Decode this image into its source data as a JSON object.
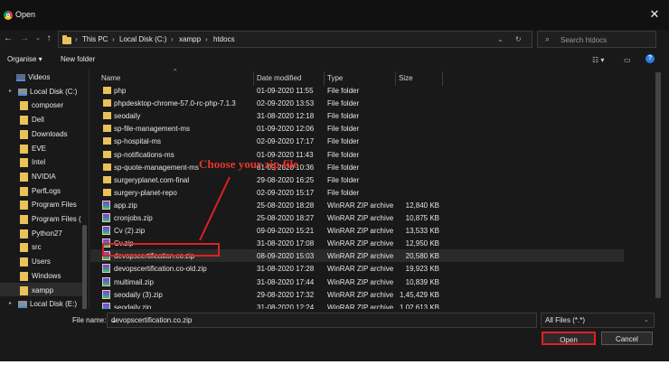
{
  "window": {
    "title": "Open"
  },
  "breadcrumb": [
    "This PC",
    "Local Disk (C:)",
    "xampp",
    "htdocs"
  ],
  "search": {
    "placeholder": "Search htdocs"
  },
  "toolbar": {
    "organise": "Organise ▾",
    "new_folder": "New folder"
  },
  "nav": [
    {
      "label": "Videos",
      "kind": "video",
      "indent": 1
    },
    {
      "label": "Local Disk (C:)",
      "kind": "drive",
      "indent": 0
    },
    {
      "label": "composer",
      "kind": "folder",
      "indent": 2
    },
    {
      "label": "Dell",
      "kind": "folder",
      "indent": 2
    },
    {
      "label": "Downloads",
      "kind": "folder",
      "indent": 2
    },
    {
      "label": "EVE",
      "kind": "folder",
      "indent": 2
    },
    {
      "label": "Intel",
      "kind": "folder",
      "indent": 2
    },
    {
      "label": "NVIDIA",
      "kind": "folder",
      "indent": 2
    },
    {
      "label": "PerfLogs",
      "kind": "folder",
      "indent": 2
    },
    {
      "label": "Program Files",
      "kind": "folder",
      "indent": 2
    },
    {
      "label": "Program Files (",
      "kind": "folder",
      "indent": 2
    },
    {
      "label": "Python27",
      "kind": "folder",
      "indent": 2
    },
    {
      "label": "src",
      "kind": "folder",
      "indent": 2
    },
    {
      "label": "Users",
      "kind": "folder",
      "indent": 2
    },
    {
      "label": "Windows",
      "kind": "folder",
      "indent": 2
    },
    {
      "label": "xampp",
      "kind": "folder",
      "indent": 2,
      "selected": true
    },
    {
      "label": "Local Disk (E:)",
      "kind": "drive",
      "indent": 0
    }
  ],
  "columns": {
    "name": "Name",
    "date": "Date modified",
    "type": "Type",
    "size": "Size"
  },
  "files": [
    {
      "name": "php",
      "date": "01-09-2020 11:55",
      "type": "File folder",
      "size": "",
      "kind": "folder"
    },
    {
      "name": "phpdesktop-chrome-57.0-rc-php-7.1.3",
      "date": "02-09-2020 13:53",
      "type": "File folder",
      "size": "",
      "kind": "folder"
    },
    {
      "name": "seodaily",
      "date": "31-08-2020 12:18",
      "type": "File folder",
      "size": "",
      "kind": "folder"
    },
    {
      "name": "sp-file-management-ms",
      "date": "01-09-2020 12:06",
      "type": "File folder",
      "size": "",
      "kind": "folder"
    },
    {
      "name": "sp-hospital-ms",
      "date": "02-09-2020 17:17",
      "type": "File folder",
      "size": "",
      "kind": "folder"
    },
    {
      "name": "sp-notifications-ms",
      "date": "01-09-2020 11:43",
      "type": "File folder",
      "size": "",
      "kind": "folder"
    },
    {
      "name": "sp-quote-management-ms",
      "date": "01-09-2020 10:36",
      "type": "File folder",
      "size": "",
      "kind": "folder"
    },
    {
      "name": "surgeryplanet.com-final",
      "date": "29-08-2020 16:25",
      "type": "File folder",
      "size": "",
      "kind": "folder"
    },
    {
      "name": "surgery-planet-repo",
      "date": "02-09-2020 15:17",
      "type": "File folder",
      "size": "",
      "kind": "folder"
    },
    {
      "name": "app.zip",
      "date": "25-08-2020 18:28",
      "type": "WinRAR ZIP archive",
      "size": "12,840 KB",
      "kind": "zip"
    },
    {
      "name": "cronjobs.zip",
      "date": "25-08-2020 18:27",
      "type": "WinRAR ZIP archive",
      "size": "10,875 KB",
      "kind": "zip"
    },
    {
      "name": "Cv (2).zip",
      "date": "09-09-2020 15:21",
      "type": "WinRAR ZIP archive",
      "size": "13,533 KB",
      "kind": "zip"
    },
    {
      "name": "Cv.zip",
      "date": "31-08-2020 17:08",
      "type": "WinRAR ZIP archive",
      "size": "12,950 KB",
      "kind": "zip"
    },
    {
      "name": "devopscertification.co.zip",
      "date": "08-09-2020 15:03",
      "type": "WinRAR ZIP archive",
      "size": "20,580 KB",
      "kind": "zip",
      "selected": true
    },
    {
      "name": "devopscertification.co-old.zip",
      "date": "31-08-2020 17:28",
      "type": "WinRAR ZIP archive",
      "size": "19,923 KB",
      "kind": "zip"
    },
    {
      "name": "multimail.zip",
      "date": "31-08-2020 17:44",
      "type": "WinRAR ZIP archive",
      "size": "10,839 KB",
      "kind": "zip"
    },
    {
      "name": "seodaily (3).zip",
      "date": "29-08-2020 17:32",
      "type": "WinRAR ZIP archive",
      "size": "1,45,429 KB",
      "kind": "zip"
    },
    {
      "name": "seodaily.zip",
      "date": "31-08-2020 12:24",
      "type": "WinRAR ZIP archive",
      "size": "1,02,613 KB",
      "kind": "zip"
    }
  ],
  "footer": {
    "file_name_label": "File name:",
    "file_name_value": "devopscertification.co.zip",
    "file_type": "All Files (*.*)",
    "open": "Open",
    "cancel": "Cancel"
  },
  "annotation": {
    "text": "Choose your zip file",
    "color": "#e8332f"
  }
}
